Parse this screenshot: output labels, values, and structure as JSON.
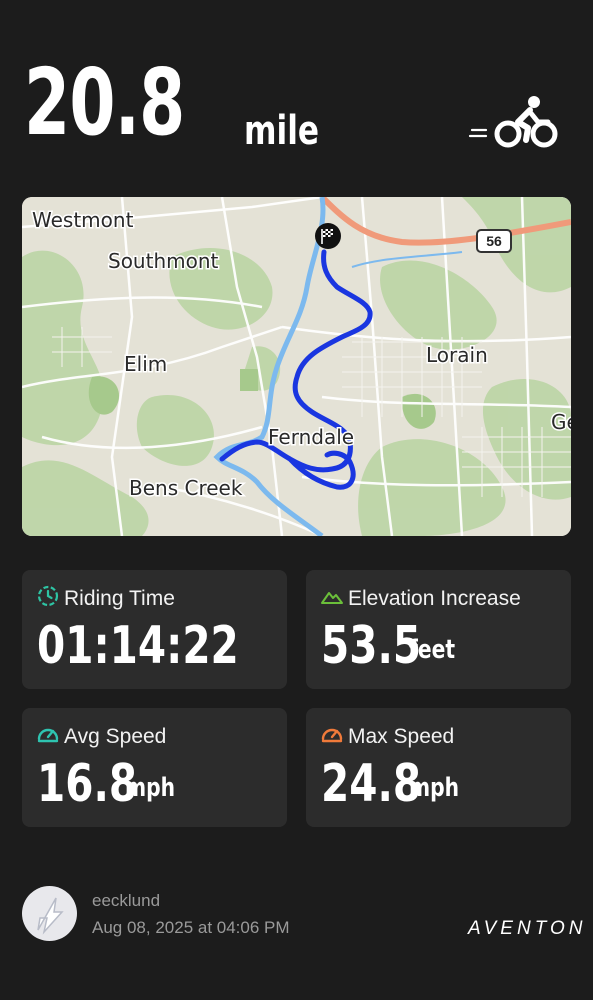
{
  "summary": {
    "distance": "20.8",
    "distance_unit": "mile",
    "activity_icon": "cycling-icon"
  },
  "map": {
    "labels": [
      "Westmont",
      "Southmont",
      "Elim",
      "Ferndale",
      "Bens Creek",
      "Lorain",
      "Ge"
    ],
    "route_shield": "56",
    "finish_icon": "checkered-flag-icon",
    "route_color": "#1a36e0"
  },
  "stats": {
    "riding_time": {
      "label": "Riding Time",
      "value": "01:14:22",
      "unit": "",
      "icon": "timer-icon",
      "icon_color": "#2ec4a4"
    },
    "elevation": {
      "label": "Elevation Increase",
      "value": "53.5",
      "unit": "feet",
      "icon": "mountain-icon",
      "icon_color": "#6bbf3a"
    },
    "avg_speed": {
      "label": "Avg Speed",
      "value": "16.8",
      "unit": "mph",
      "icon": "speedometer-icon",
      "icon_color": "#2ec4b0"
    },
    "max_speed": {
      "label": "Max Speed",
      "value": "24.8",
      "unit": "mph",
      "icon": "speedometer-icon",
      "icon_color": "#f07a3a"
    }
  },
  "footer": {
    "username": "eecklund",
    "date": "Aug 08, 2025 at 04:06 PM",
    "brand": "AVENTON"
  }
}
